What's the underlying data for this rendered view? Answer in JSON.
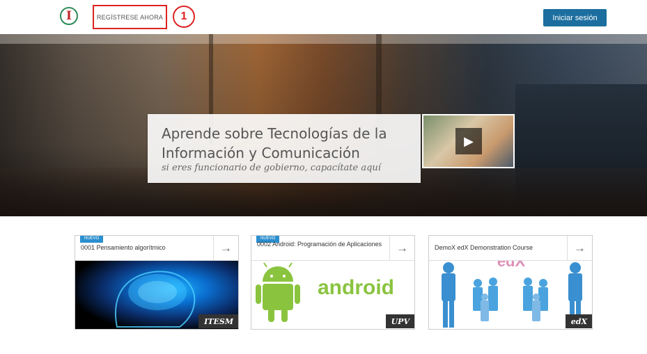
{
  "header": {
    "logo_letter": "I",
    "register_label": "REGÍSTRESE AHORA",
    "step_number": "1",
    "login_label": "Iniciar sesión"
  },
  "hero": {
    "title": "Aprende sobre Tecnologías de la Información y Comunicación",
    "subtitle": "si eres funcionario de gobierno, capacítate aquí"
  },
  "courses": [
    {
      "title": "0001 Pensamiento algorítmico",
      "badge": "NUEVO",
      "org": "ITESM"
    },
    {
      "title": "0002 Android: Programación de Aplicaciones",
      "badge": "NUEVO",
      "org": "UPV",
      "image_text": "android"
    },
    {
      "title": "DemoX edX Demonstration Course",
      "badge": "",
      "org": "edX",
      "image_text": "edX"
    }
  ],
  "icons": {
    "arrow": "→",
    "play": "▶"
  }
}
